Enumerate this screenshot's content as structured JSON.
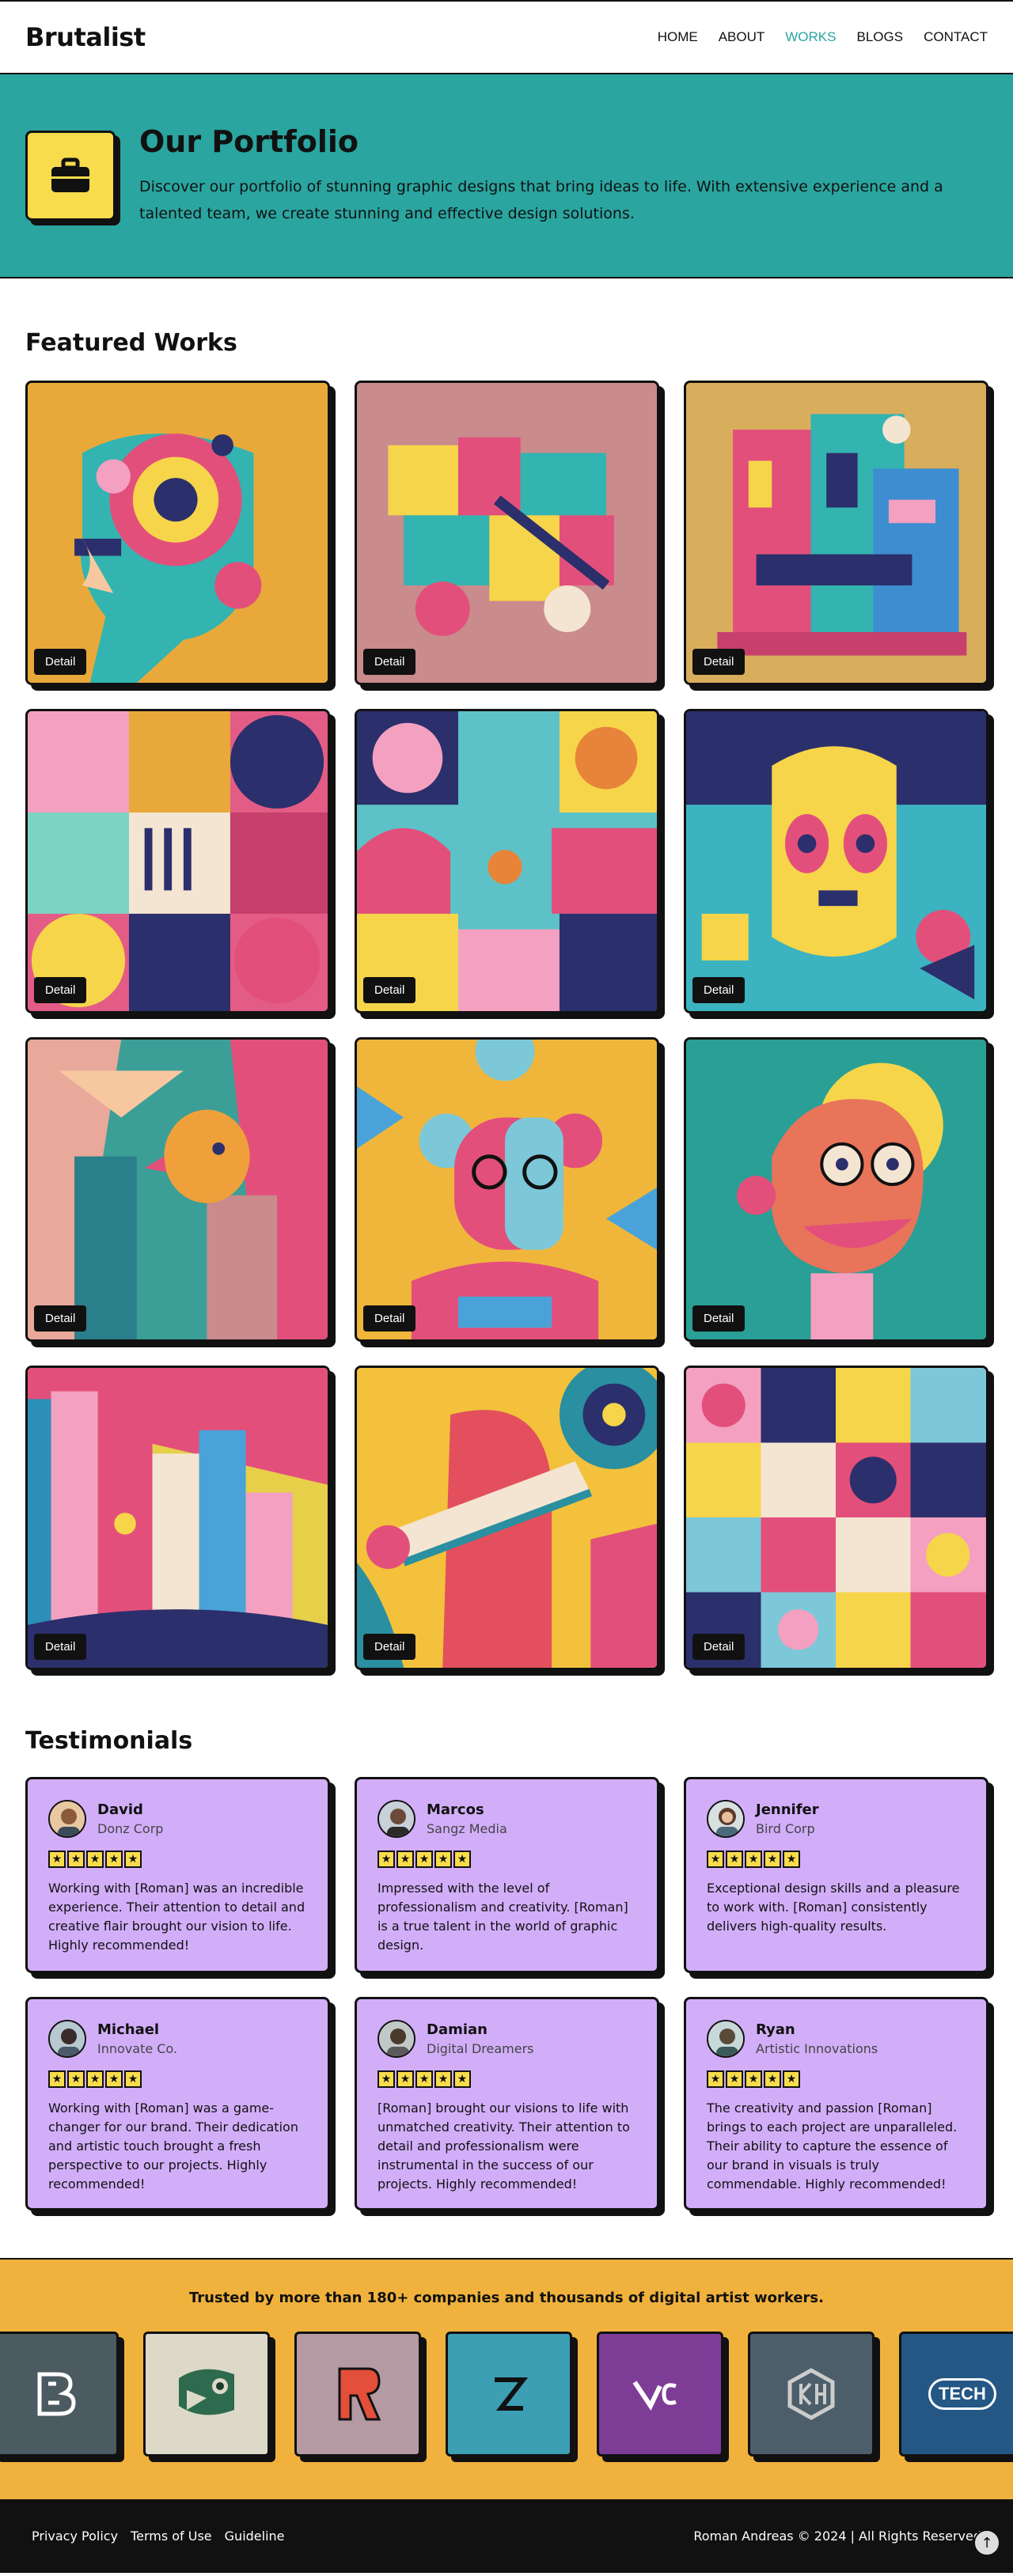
{
  "nav": {
    "brand": "Brutalist",
    "items": [
      {
        "label": "HOME",
        "active": false
      },
      {
        "label": "ABOUT",
        "active": false
      },
      {
        "label": "WORKS",
        "active": true
      },
      {
        "label": "BLOGS",
        "active": false
      },
      {
        "label": "CONTACT",
        "active": false
      }
    ]
  },
  "hero": {
    "icon": "briefcase-icon",
    "title": "Our Portfolio",
    "description": "Discover our portfolio of stunning graphic designs that bring ideas to life. With extensive experience and a talented team, we create stunning and effective design solutions."
  },
  "works": {
    "title": "Featured Works",
    "detail_label": "Detail",
    "items": [
      {
        "subject": "profile-head-artwork",
        "bg": "#e8a93a"
      },
      {
        "subject": "abstract-objects-artwork",
        "bg": "#c98b8c"
      },
      {
        "subject": "building-artwork",
        "bg": "#d8ad5c"
      },
      {
        "subject": "geometric-pattern-artwork",
        "bg": "#e35c86"
      },
      {
        "subject": "abstract-shapes-artwork",
        "bg": "#5dc2c7"
      },
      {
        "subject": "face-collage-artwork",
        "bg": "#3cb3c0"
      },
      {
        "subject": "city-bird-artwork",
        "bg": "#3b9f97"
      },
      {
        "subject": "robot-face-artwork",
        "bg": "#f0b63b"
      },
      {
        "subject": "cartoon-face-artwork",
        "bg": "#2a9f95"
      },
      {
        "subject": "city-skyline-artwork",
        "bg": "#e6d04a"
      },
      {
        "subject": "scroll-abstract-artwork",
        "bg": "#f3c13c"
      },
      {
        "subject": "pattern-grid-artwork",
        "bg": "#e34f7b"
      }
    ]
  },
  "testimonials": {
    "title": "Testimonials",
    "items": [
      {
        "name": "David",
        "company": "Donz Corp",
        "rating": 5,
        "quote": "Working with [Roman] was an incredible experience. Their attention to detail and creative flair brought our vision to life. Highly recommended!"
      },
      {
        "name": "Marcos",
        "company": "Sangz Media",
        "rating": 5,
        "quote": "Impressed with the level of professionalism and creativity. [Roman] is a true talent in the world of graphic design."
      },
      {
        "name": "Jennifer",
        "company": "Bird Corp",
        "rating": 5,
        "quote": "Exceptional design skills and a pleasure to work with. [Roman] consistently delivers high-quality results."
      },
      {
        "name": "Michael",
        "company": "Innovate Co.",
        "rating": 5,
        "quote": "Working with [Roman] was a game-changer for our brand. Their dedication and artistic touch brought a fresh perspective to our projects. Highly recommended!"
      },
      {
        "name": "Damian",
        "company": "Digital Dreamers",
        "rating": 5,
        "quote": "[Roman] brought our visions to life with unmatched creativity. Their attention to detail and professionalism were instrumental in the success of our projects. Highly recommended!"
      },
      {
        "name": "Ryan",
        "company": "Artistic Innovations",
        "rating": 5,
        "quote": "The creativity and passion [Roman] brings to each project are unparalleled. Their ability to capture the essence of our brand in visuals is truly commendable. Highly recommended!"
      }
    ]
  },
  "clients": {
    "title": "Trusted by more than 180+ companies and thousands of digital artist workers.",
    "logos": [
      {
        "icon": "b-logo-icon",
        "bg": "#4c5a61"
      },
      {
        "icon": "swirl-logo-icon",
        "bg": "#dcd9c8"
      },
      {
        "icon": "r-logo-icon",
        "bg": "#b59aa3"
      },
      {
        "icon": "z-logo-icon",
        "bg": "#3c9fb4"
      },
      {
        "icon": "ec-logo-icon",
        "bg": "#7d3d97"
      },
      {
        "icon": "kh-logo-icon",
        "bg": "#4c5e6a"
      },
      {
        "text": "TECH",
        "icon": "tech-logo-icon",
        "bg": "#245784"
      }
    ]
  },
  "footer": {
    "links": [
      "Privacy Policy",
      "Terms of Use",
      "Guideline"
    ],
    "copyright": "Roman Andreas © 2024 | All Rights Reserved",
    "to_top_icon": "arrow-up-icon"
  }
}
